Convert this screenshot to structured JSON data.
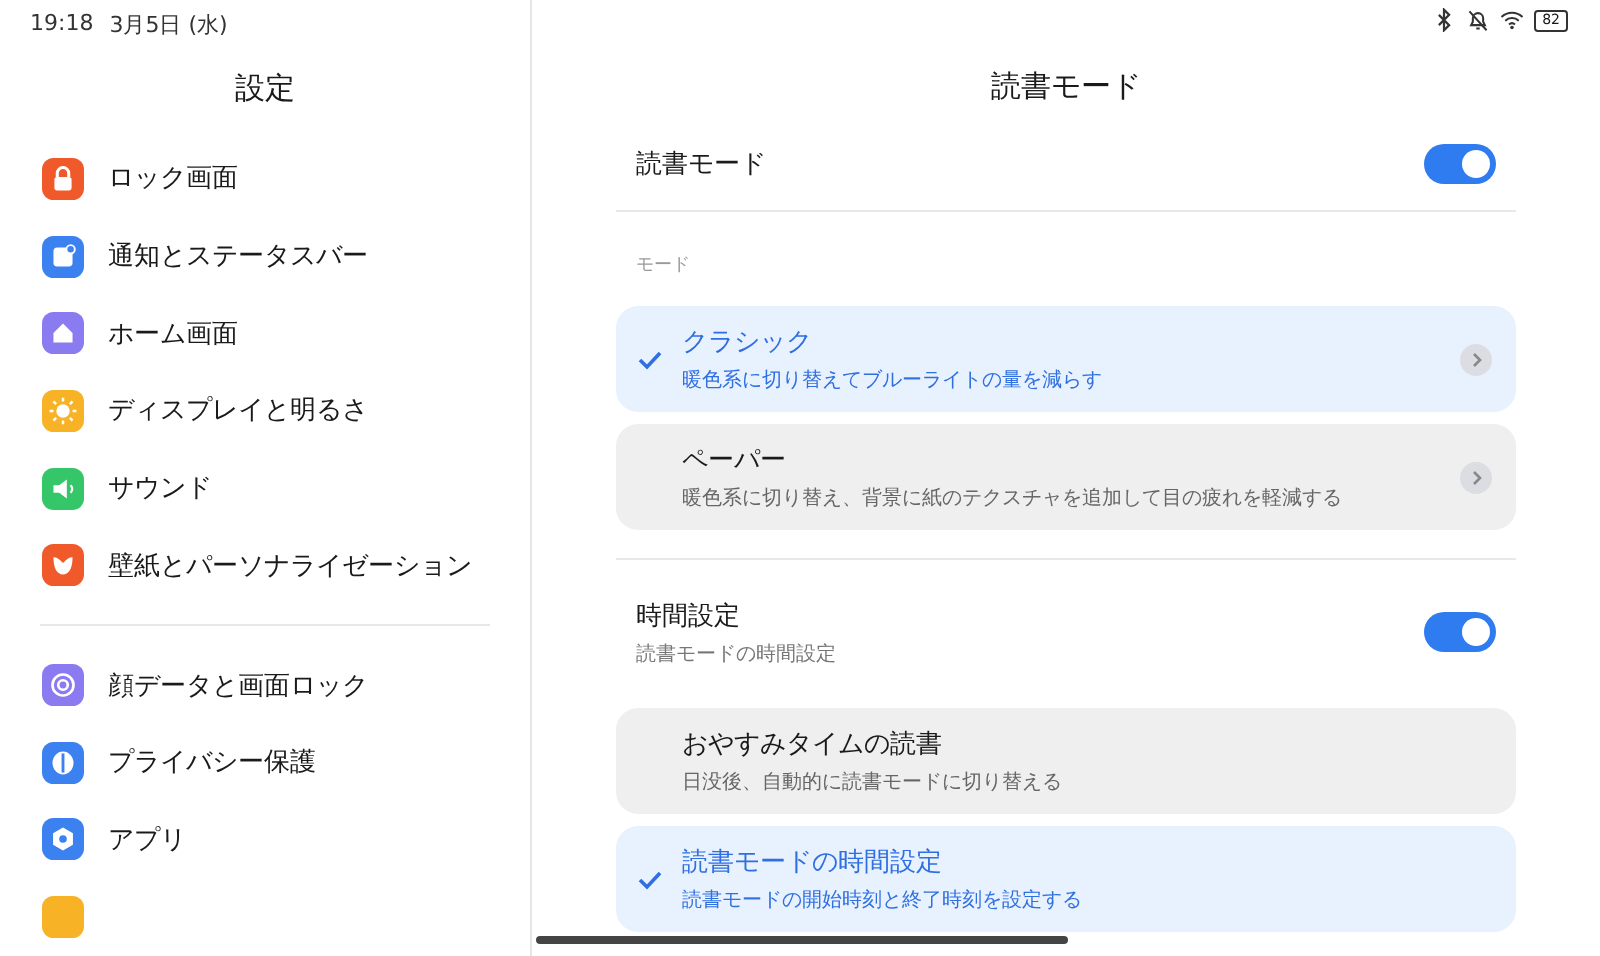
{
  "status_bar": {
    "time": "19:18",
    "date": "3月5日 (水)",
    "battery": "82"
  },
  "sidebar": {
    "title": "設定",
    "groups": [
      {
        "items": [
          {
            "label": "ロック画面",
            "color": "#f05a2a"
          },
          {
            "label": "通知とステータスバー",
            "color": "#3b82f0"
          },
          {
            "label": "ホーム画面",
            "color": "#8a7cf0"
          },
          {
            "label": "ディスプレイと明るさ",
            "color": "#f7b226"
          },
          {
            "label": "サウンド",
            "color": "#35c66a"
          },
          {
            "label": "壁紙とパーソナライゼーション",
            "color": "#f05a2a"
          }
        ]
      },
      {
        "items": [
          {
            "label": "顔データと画面ロック",
            "color": "#8a7cf0"
          },
          {
            "label": "プライバシー保護",
            "color": "#3b82f0"
          },
          {
            "label": "アプリ",
            "color": "#3b82f0"
          },
          {
            "color": "#f7b226"
          }
        ]
      }
    ]
  },
  "panel": {
    "title": "読書モード",
    "main_toggle": {
      "label": "読書モード",
      "on": true
    },
    "mode_section": {
      "header": "モード",
      "options": [
        {
          "chevron": true,
          "title": "クラシック",
          "subtitle": "暖色系に切り替えてブルーライトの量を減らす",
          "selected": true
        },
        {
          "chevron": true,
          "title": "ペーパー",
          "subtitle": "暖色系に切り替え、背景に紙のテクスチャを追加して目の疲れを軽減する",
          "selected": false
        }
      ]
    },
    "schedule_toggle": {
      "label": "時間設定",
      "subtitle": "読書モードの時間設定",
      "on": true
    },
    "schedule_options": [
      {
        "chevron": false,
        "title": "おやすみタイムの読書",
        "subtitle": "日没後、自動的に読書モードに切り替える",
        "selected": false
      },
      {
        "chevron": false,
        "title": "読書モードの時間設定",
        "subtitle": "読書モードの開始時刻と終了時刻を設定する",
        "selected": true
      }
    ]
  }
}
